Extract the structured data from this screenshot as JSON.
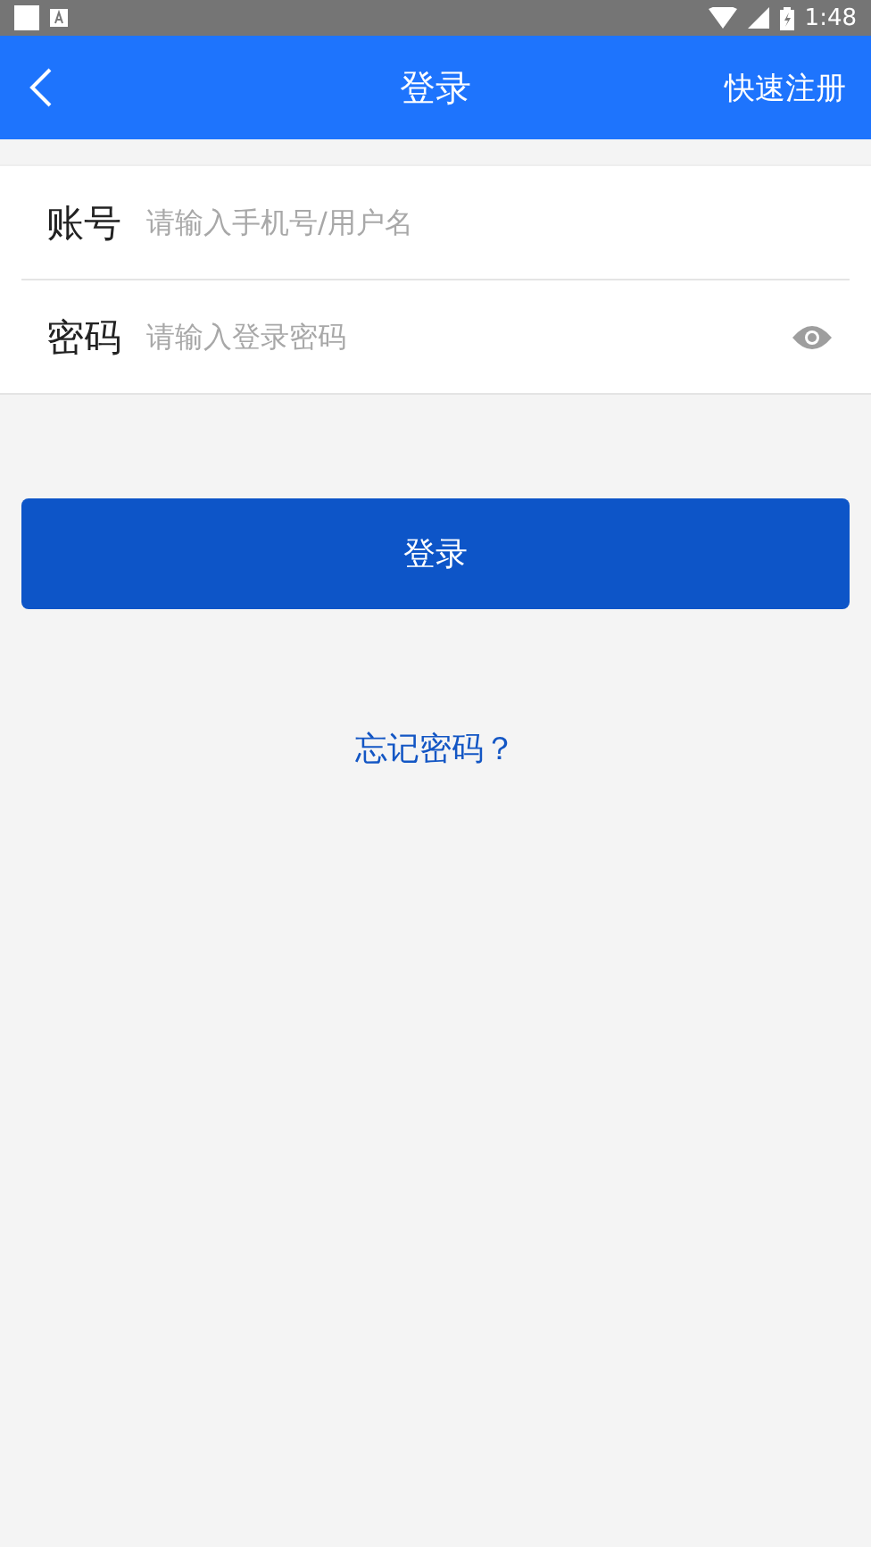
{
  "status_bar": {
    "time": "1:48"
  },
  "header": {
    "title": "登录",
    "action": "快速注册"
  },
  "fields": [
    {
      "label": "账号",
      "placeholder": "请输入手机号/用户名",
      "kind": "text"
    },
    {
      "label": "密码",
      "placeholder": "请输入登录密码",
      "kind": "password"
    }
  ],
  "submit": "登录",
  "forgot_link": "忘记密码？"
}
